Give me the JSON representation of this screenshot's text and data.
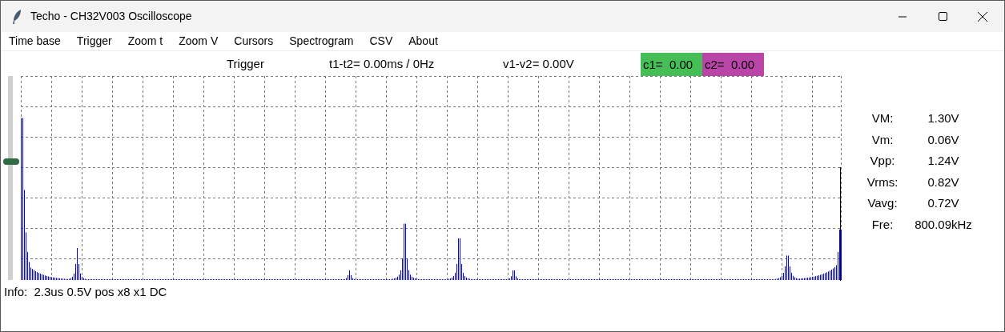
{
  "window": {
    "title": "Techo - CH32V003 Oscilloscope"
  },
  "menu": [
    "Time base",
    "Trigger",
    "Zoom t",
    "Zoom V",
    "Cursors",
    "Spectrogram",
    "CSV",
    "About"
  ],
  "header": {
    "trigger": "Trigger",
    "time_delta": "t1-t2= 0.00ms / 0Hz",
    "volt_delta": "v1-v2= 0.00V",
    "cursors": [
      {
        "label": "c1=  0.00",
        "color": "#45bf55"
      },
      {
        "label": "c2=  0.00",
        "color": "#b945a8"
      }
    ]
  },
  "level_slider": {
    "level": 0.58
  },
  "measurements": [
    {
      "label": "VM:",
      "value": "1.30V"
    },
    {
      "label": "Vm:",
      "value": "0.06V"
    },
    {
      "label": "Vpp:",
      "value": "1.24V"
    },
    {
      "label": "Vrms:",
      "value": "0.82V"
    },
    {
      "label": "Vavg:",
      "value": "0.72V"
    },
    {
      "label": "Fre:",
      "value": "800.09kHz"
    }
  ],
  "info": "Info:  2.3us 0.5V pos x8 x1 DC"
}
